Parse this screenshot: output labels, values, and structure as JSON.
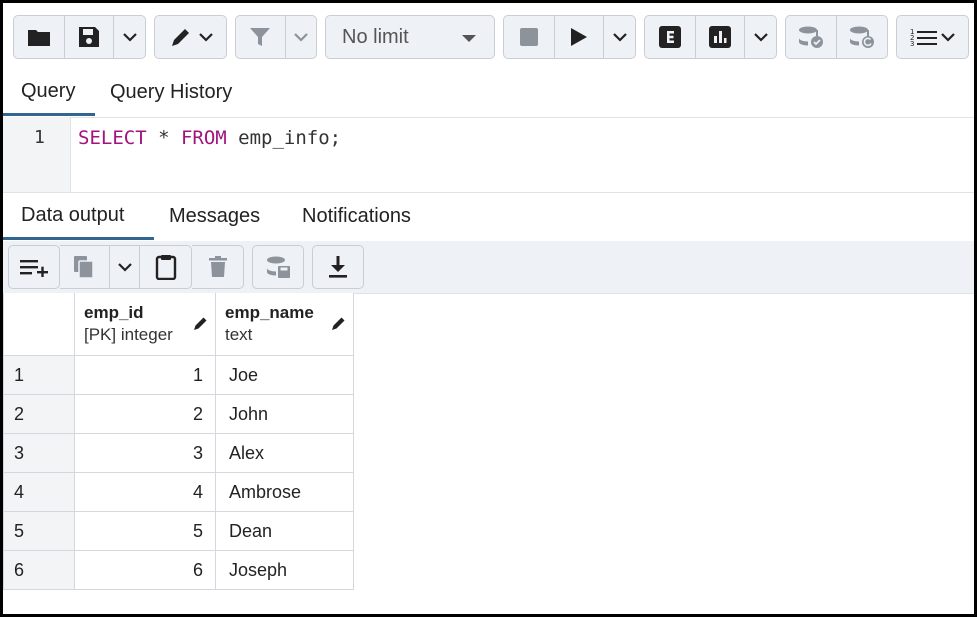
{
  "toolbar": {
    "limit_value": "No limit",
    "icons": [
      "folder-icon",
      "save-icon",
      "chevron-down-icon",
      "pencil-icon",
      "filter-icon",
      "stop-icon",
      "play-icon",
      "explain-icon",
      "explain-analyze-icon",
      "commit-icon",
      "rollback-icon",
      "macros-icon"
    ]
  },
  "query_tabs": [
    "Query",
    "Query History"
  ],
  "editor": {
    "line_number": "1",
    "sql": {
      "kw1": "SELECT",
      "star": " * ",
      "kw2": "FROM",
      "rest": " emp_info;"
    }
  },
  "result_tabs": [
    "Data output",
    "Messages",
    "Notifications"
  ],
  "grid": {
    "columns": [
      {
        "name": "emp_id",
        "type": "[PK] integer"
      },
      {
        "name": "emp_name",
        "type": "text"
      }
    ],
    "rows": [
      {
        "n": "1",
        "id": "1",
        "name": "Joe"
      },
      {
        "n": "2",
        "id": "2",
        "name": "John"
      },
      {
        "n": "3",
        "id": "3",
        "name": "Alex"
      },
      {
        "n": "4",
        "id": "4",
        "name": "Ambrose"
      },
      {
        "n": "5",
        "id": "5",
        "name": "Dean"
      },
      {
        "n": "6",
        "id": "6",
        "name": "Joseph"
      }
    ]
  },
  "colors": {
    "accent": "#326690",
    "keyword": "#a3127e"
  }
}
